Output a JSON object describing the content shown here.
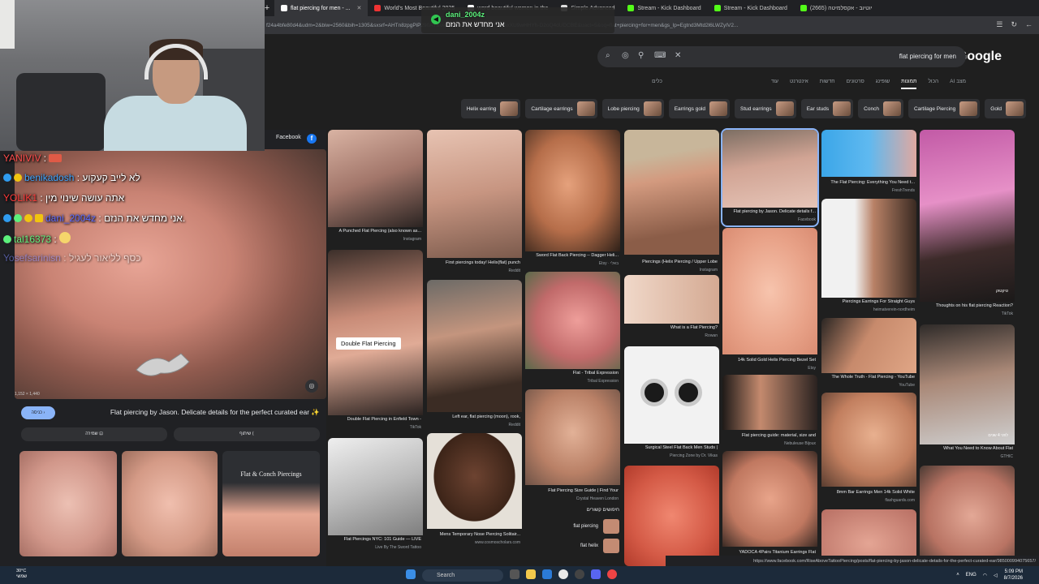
{
  "browser": {
    "tabs": [
      {
        "title": "flat piercing for men - ...",
        "favicon": "google-icon",
        "active": true
      },
      {
        "title": "World's Most Beautiful 2025",
        "favicon": "video-icon",
        "active": false
      },
      {
        "title": "word beautiful women in the",
        "favicon": "google-icon",
        "active": false
      },
      {
        "title": "Simple Advanced",
        "favicon": "page-icon",
        "active": false
      },
      {
        "title": "Stream - Kick Dashboard",
        "favicon": "kick-icon",
        "active": false
      },
      {
        "title": "Stream - Kick Dashboard",
        "favicon": "kick-icon",
        "active": false
      },
      {
        "title": "יוטיוב - אקסלמיטה (2665)",
        "favicon": "kick-icon",
        "active": false
      }
    ],
    "url": "f24a4bfe80d4&udm=2&biw=2560&bih=1305&sxsrf=AHTn8zpgPiP290AY&ved=0ahUKEwi7hdDc2I6WAxXU9wHHYh-D2oQ4dUDCBE&uact=5&oq=flat+piercing+for+men&gs_lp=Egtnd3Mtd2l6LWZyIV2..."
  },
  "notification": {
    "user": "dani_2004z",
    "text": "אני מחדש את הנזם"
  },
  "google": {
    "logo": "Google",
    "query": "flat piercing for men",
    "tabs": [
      "מצב AI",
      "הכול",
      "תמונות",
      "שופינג",
      "סרטונים",
      "חדשות",
      "אינטרנט",
      "עוד",
      "כלים"
    ],
    "active_tab": "תמונות",
    "chips": [
      "Helix earring",
      "Cartilage earrings",
      "Lobe piercing",
      "Earrings gold",
      "Stud earrings",
      "Ear studs",
      "Conch",
      "Cartilage Piercing",
      "Gold"
    ]
  },
  "results": {
    "col1": [
      {
        "caption": "A Punched Flat Piercing (also known as...",
        "source": "Instagram"
      },
      {
        "caption": "Double Flat Piercing in Enfield Town -",
        "source": "TikTok",
        "overlay": "Double Flat Piercing"
      },
      {
        "caption": "Flat Piercings NYC: 101 Guide — LIVE",
        "source": "Live By The Sword Tattoo"
      }
    ],
    "col2": [
      {
        "caption": "First piercings today! Helix(flat) punch",
        "source": "Reddit"
      },
      {
        "caption": "Left ear, flat piercing (moon), rook,",
        "source": "Reddit"
      },
      {
        "caption": "Mens Temporary Nose Piercing Solitair...",
        "source": "www.cosmoscholars.com"
      }
    ],
    "col3": [
      {
        "caption": "Sword Flat Back Piercing -- Dagger Heli...",
        "source": "Etsy · באלי"
      },
      {
        "caption": "Flat - Tribal Expression",
        "source": "Tribal Expression"
      },
      {
        "caption": "Flat Piercing Size Guide | Find Your",
        "source": "Crystal Heaven London"
      }
    ],
    "related_title": "חיפושים קשורים",
    "related_items": [
      "flat piercing",
      "flat helix"
    ],
    "col4": [
      {
        "caption": "Piercings (Helix Piercing / Upper Lobe",
        "source": "Instagram"
      },
      {
        "caption": "What is a Flat Piercing?",
        "source": "Rowan"
      },
      {
        "caption": "Surgical Steel Flat Back Men Studs |",
        "source": "Piercing Zone by Dr. Vikas"
      }
    ],
    "col5": [
      {
        "caption": "Flat piercing by Jason. Delicate details f...",
        "source": "Facebook"
      },
      {
        "caption": "14k Solid Gold Helix Piercing Bezel Set",
        "source": "Etsy"
      },
      {
        "caption": "Flat piercing guide: material, size and",
        "source": "Nebuleuse Bijoux"
      },
      {
        "caption": "YADOCA 4Pairs Titanium Earrings Flat",
        "source": ""
      }
    ],
    "col6": [
      {
        "caption": "The Flat Piercing: Everything You Need t...",
        "source": "FreshTrends"
      },
      {
        "caption": "Piercings Earrings For Straight Guys",
        "source": "heimatverein-nordheim"
      },
      {
        "caption": "The Whole Truth - Flat Piercing - YouTube",
        "source": "YouTube"
      },
      {
        "caption": "8mm Bar Earrings Men 14k Solid White",
        "source": "flashguards.com"
      }
    ],
    "col7": [
      {
        "caption": "Thoughts on his flat piercing Reaction?",
        "source": "TikTok",
        "badge": "טיקטוק"
      },
      {
        "caption": "What You Need to Know About Flat",
        "source": "GTHIC",
        "badge": "לפני 4 שנים"
      }
    ]
  },
  "preview": {
    "source": "Facebook",
    "dims": "1,152 × 1,440",
    "visit_label": "כניסה",
    "title": "Flat piercing by Jason. Delicate details for the perfect curated ear ✨",
    "save_label": "שמירה",
    "share_label": "שיתוף",
    "thumb_label": "Flat & Conch Piercings"
  },
  "chat": [
    {
      "user": "YANIVIV",
      "text": "",
      "color": "#ff4d4d"
    },
    {
      "user": "benikadosh",
      "text": "לא לייב קעקוע",
      "color": "#3ea6ff"
    },
    {
      "user": "YOLIK1",
      "text": "אתה עושה שינוי מין",
      "color": "#ff3b3b"
    },
    {
      "user": "dani_2004z",
      "text": "אני מחדש את הנזם.",
      "color": "#5b6bff"
    },
    {
      "user": "tal16373",
      "text": "",
      "color": "#62f27f"
    },
    {
      "user": "Yosefsarinisn",
      "text": "כסף לליאור לעגיל",
      "color": "#7e89ff"
    }
  ],
  "status_url": "https://www.facebook.com/RiseAboveTattooPiercing/posts/flat-piercing-by-jason-delicate-details-for-the-perfect-curated-ear/985000994075657/",
  "taskbar": {
    "weather_temp": "30°C",
    "weather_desc": "שמשי",
    "search_label": "Search",
    "lang": "ENG",
    "time": "5:09 PM",
    "date": "8/7/2026"
  }
}
